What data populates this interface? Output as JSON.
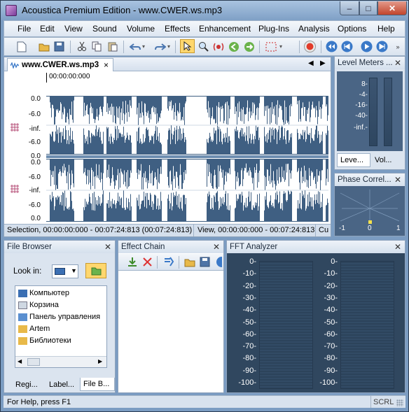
{
  "window": {
    "title": "Acoustica Premium Edition - www.CWER.ws.mp3"
  },
  "menu": [
    "File",
    "Edit",
    "View",
    "Sound",
    "Volume",
    "Effects",
    "Enhancement",
    "Plug-Ins",
    "Analysis",
    "Options",
    "Help"
  ],
  "toolbar_icons": [
    "new-file-icon",
    "open-folder-icon",
    "save-icon",
    "cut-icon",
    "copy-icon",
    "paste-icon",
    "undo-icon",
    "redo-icon",
    "select-cursor-icon",
    "zoom-icon",
    "scrub-icon",
    "play-region-icon",
    "loop-icon",
    "selection-grid-icon",
    "record-icon",
    "rewind-icon",
    "back-icon",
    "play-icon",
    "forward-icon"
  ],
  "doc_tab": {
    "label": "www.CWER.ws.mp3",
    "close": "×"
  },
  "wave": {
    "timecode": "00:00:00:000",
    "ch1_scale": [
      "0.0",
      "-6.0",
      "-inf.",
      "-6.0",
      "0.0"
    ],
    "ch2_scale": [
      "0.0",
      "-6.0",
      "-inf.",
      "-6.0",
      "0.0"
    ]
  },
  "status_sel": {
    "selection": "Selection, 00:00:00:000 - 00:07:24:813 (00:07:24:813)",
    "view": "View, 00:00:00:000 - 00:07:24:813",
    "cursor": "Cu"
  },
  "level_meters": {
    "title": "Level Meters ...",
    "scale": [
      "8-",
      "-4-",
      "-16-",
      "-40-",
      "-inf.-"
    ],
    "tabs": [
      "Leve...",
      "Vol..."
    ]
  },
  "phase": {
    "title": "Phase Correl...",
    "scale": [
      "-1",
      "0",
      "1"
    ]
  },
  "file_browser": {
    "title": "File Browser",
    "look_in": "Look in:",
    "items": [
      "Компьютер",
      "Корзина",
      "Панель управления",
      "Artem",
      "Библиотеки"
    ],
    "tabs": [
      "Regi...",
      "Label...",
      "File B..."
    ]
  },
  "effect_chain": {
    "title": "Effect Chain"
  },
  "fft": {
    "title": "FFT Analyzer",
    "scale": [
      "0-",
      "-10-",
      "-20-",
      "-30-",
      "-40-",
      "-50-",
      "-60-",
      "-70-",
      "-80-",
      "-90-",
      "-100-"
    ]
  },
  "statusbar": {
    "help": "For Help, press F1",
    "scrl": "SCRL"
  },
  "colors": {
    "wave": "#3f5f82",
    "panel_blue": "#4a6585",
    "accent": "#6d8db0"
  }
}
